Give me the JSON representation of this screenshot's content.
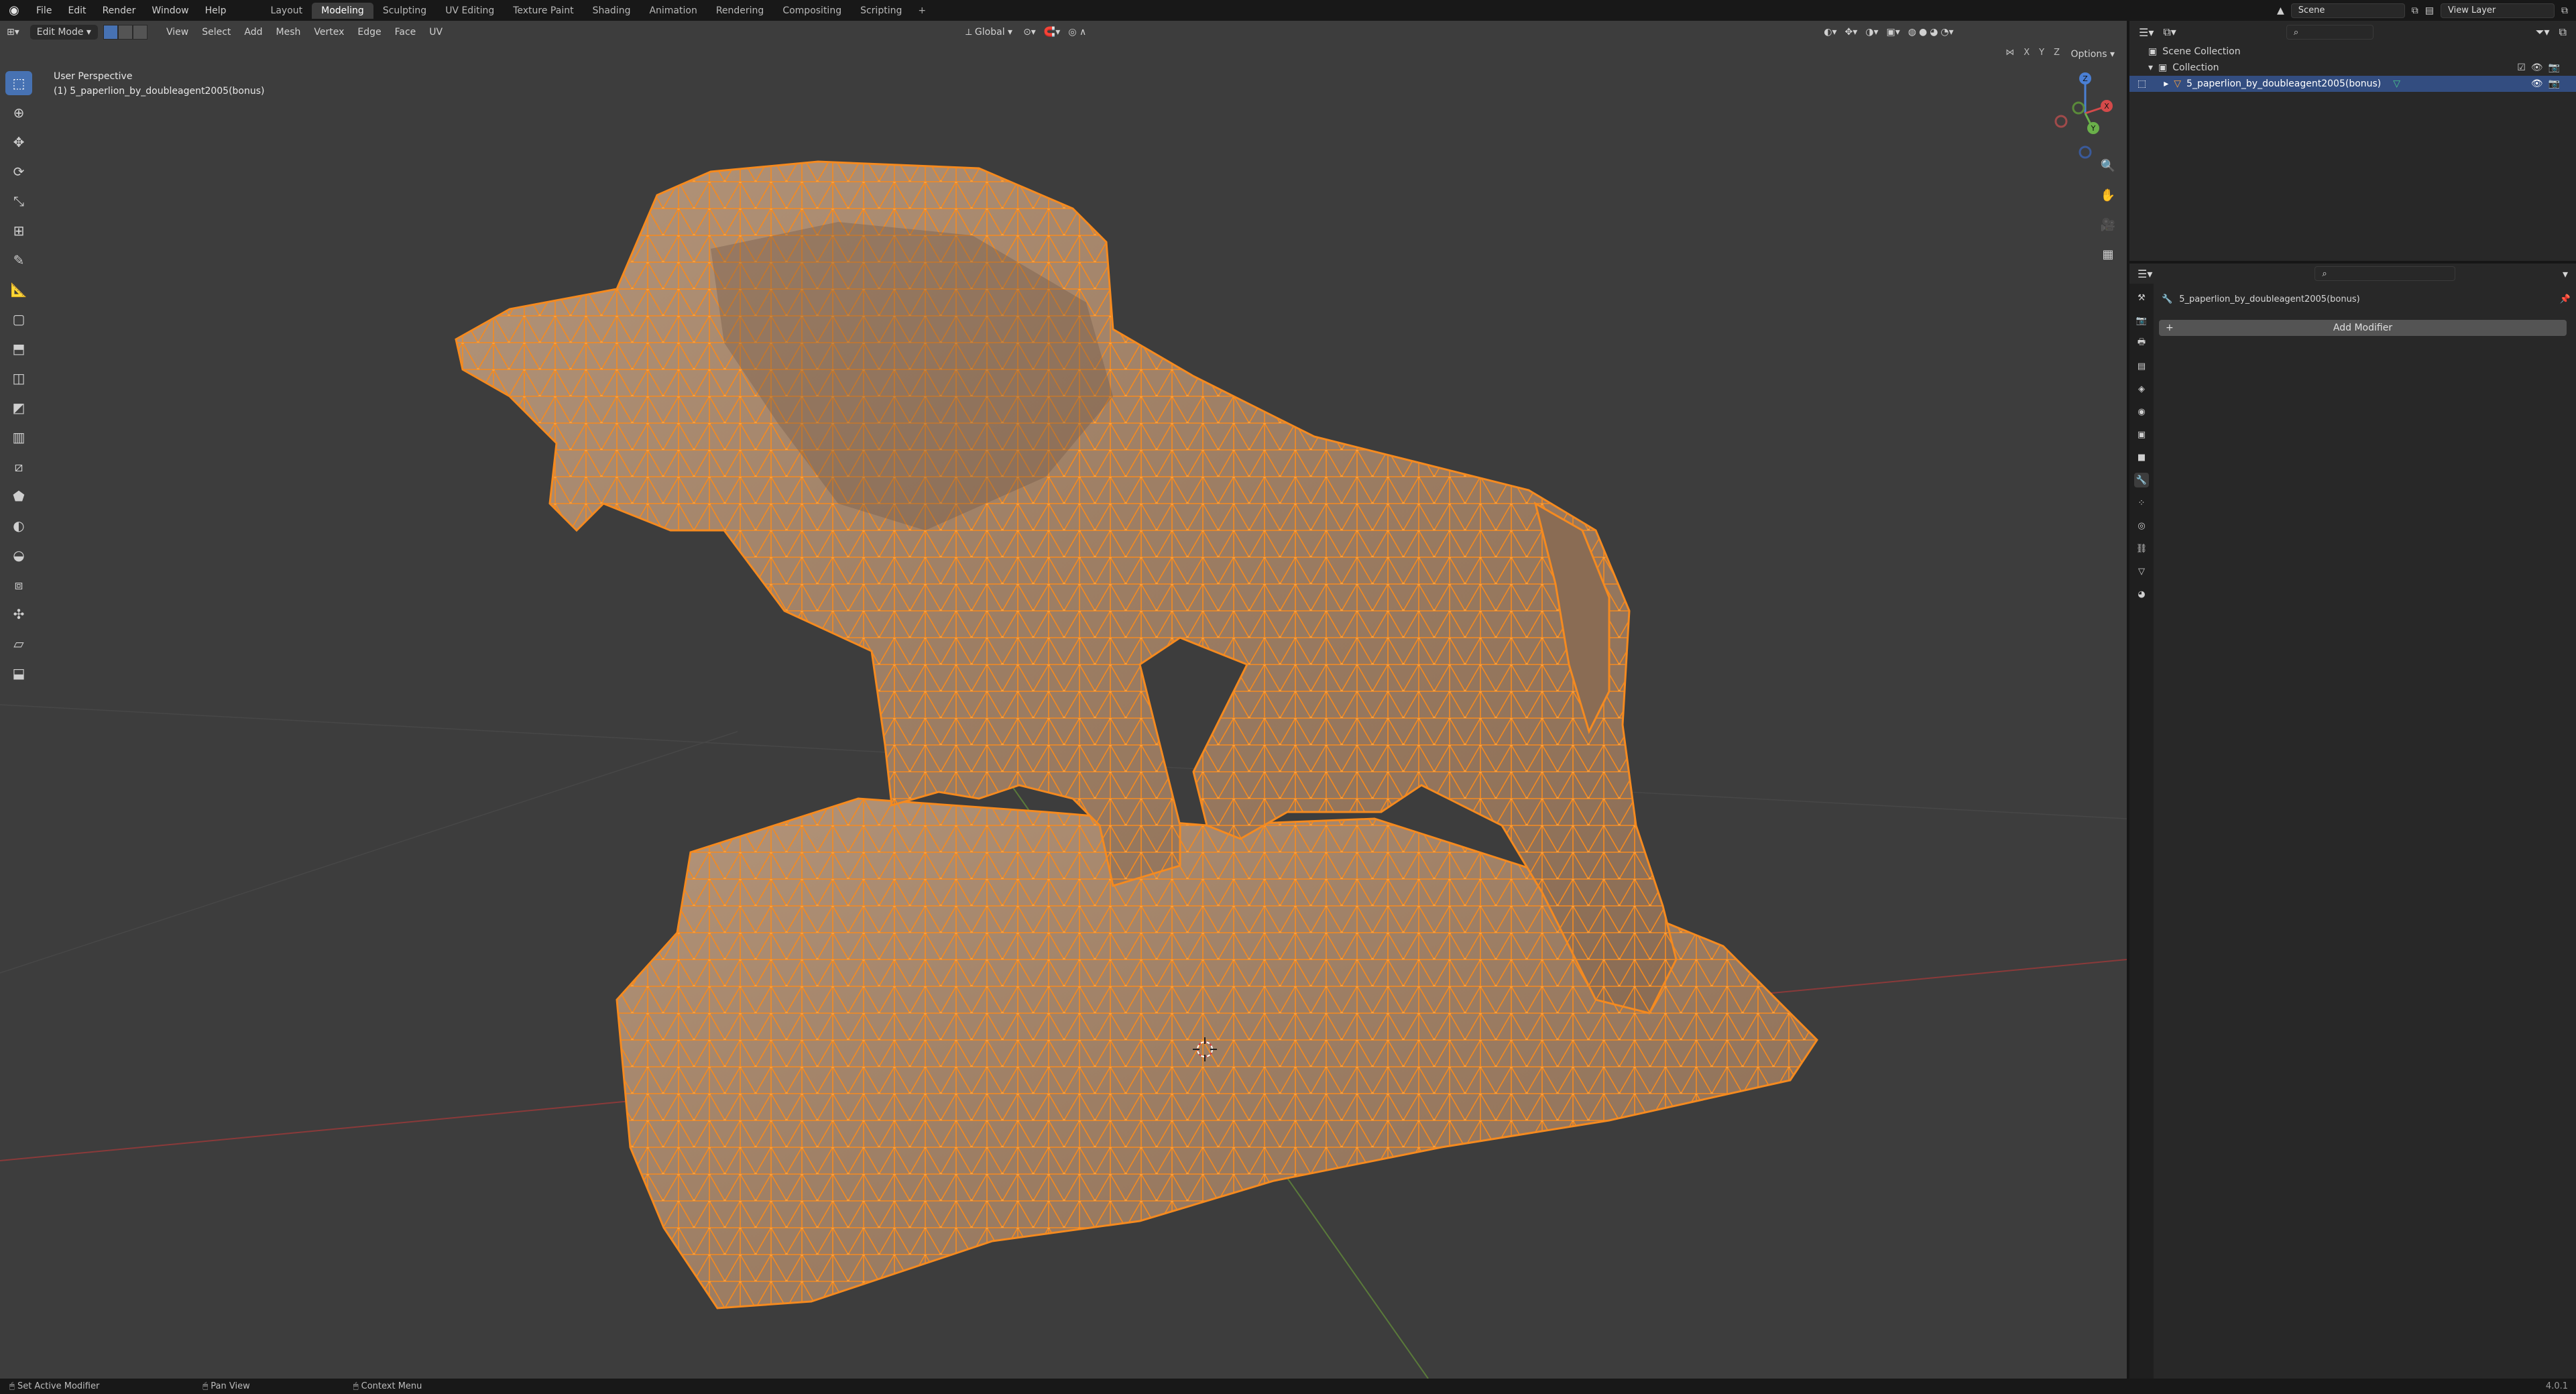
{
  "topbar": {
    "menus": [
      "File",
      "Edit",
      "Render",
      "Window",
      "Help"
    ],
    "workspaces": [
      "Layout",
      "Modeling",
      "Sculpting",
      "UV Editing",
      "Texture Paint",
      "Shading",
      "Animation",
      "Rendering",
      "Compositing",
      "Scripting"
    ],
    "active_workspace": "Modeling",
    "add_tab": "+",
    "scene_label": "Scene",
    "view_layer_label": "View Layer"
  },
  "viewport": {
    "mode": "Edit Mode",
    "menus": [
      "View",
      "Select",
      "Add",
      "Mesh",
      "Vertex",
      "Edge",
      "Face",
      "UV"
    ],
    "transform_orientation": "Global",
    "options_label": "Options",
    "perspective_label": "User Perspective",
    "object_label": "(1) 5_paperlion_by_doubleagent2005(bonus)",
    "axis_labels": {
      "x": "X",
      "y": "Y",
      "z": "Z"
    },
    "gizmo_labels": [
      "X",
      "Y",
      "Z"
    ]
  },
  "outliner": {
    "rows": [
      "Scene Collection",
      "Collection",
      "5_paperlion_by_doubleagent2005(bonus)"
    ]
  },
  "properties": {
    "object_name": "5_paperlion_by_doubleagent2005(bonus)",
    "add_modifier_label": "Add Modifier"
  },
  "statusbar": {
    "items": [
      "Set Active Modifier",
      "Pan View",
      "Context Menu"
    ],
    "version": "4.0.1"
  },
  "colors": {
    "accent": "#4772b3",
    "mesh_fill": "#a98a6f",
    "wire": "#f58a1f",
    "viewport_bg": "#3d3d3d"
  }
}
